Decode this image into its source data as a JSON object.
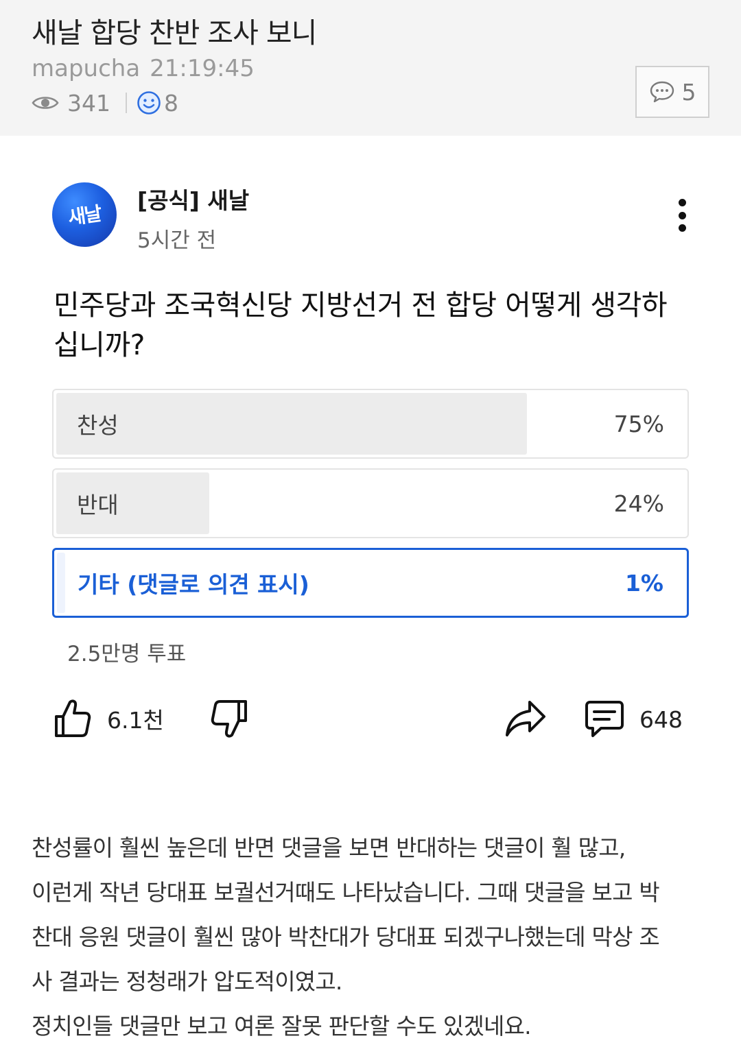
{
  "post": {
    "title": "새날 합당 찬반 조사 보니",
    "author": "mapucha",
    "time": "21:19:45",
    "views": "341",
    "reactions": "8",
    "comment_count": "5"
  },
  "card": {
    "author_avatar_text": "새날",
    "author_name": "[공식] 새날",
    "posted_ago": "5시간 전",
    "question": "민주당과 조국혁신당 지방선거 전 합당 어떻게 생각하십니까?",
    "options": [
      {
        "label": "찬성",
        "percent_text": "75%",
        "share": 0.75,
        "selected": false
      },
      {
        "label": "반대",
        "percent_text": "24%",
        "share": 0.24,
        "selected": false
      },
      {
        "label": "기타 (댓글로 의견 표시)",
        "percent_text": "1%",
        "share": 0.01,
        "selected": true
      }
    ],
    "vote_total": "2.5만명 투표",
    "likes": "6.1천",
    "comments": "648",
    "icons": [
      "thumbs-up-icon",
      "thumbs-down-icon",
      "share-icon",
      "comment-icon",
      "more-vertical-icon"
    ]
  },
  "body": {
    "lines": [
      "찬성률이 훨씬 높은데 반면 댓글을 보면 반대하는 댓글이 훨 많고,",
      "이런게 작년 당대표 보궐선거때도 나타났습니다. 그때 댓글을 보고 박",
      "찬대 응원 댓글이 훨씬 많아 박찬대가 당대표 되겠구나했는데 막상 조",
      "사 결과는 정청래가 압도적이였고.",
      "정치인들 댓글만 보고 여론 잘못 판단할 수도 있겠네요."
    ]
  },
  "colors": {
    "header_bg": "#f4f4f4",
    "selected_accent": "#1a5fd6",
    "result_fill": "#ececec",
    "avatar": "#1d5fe0"
  }
}
